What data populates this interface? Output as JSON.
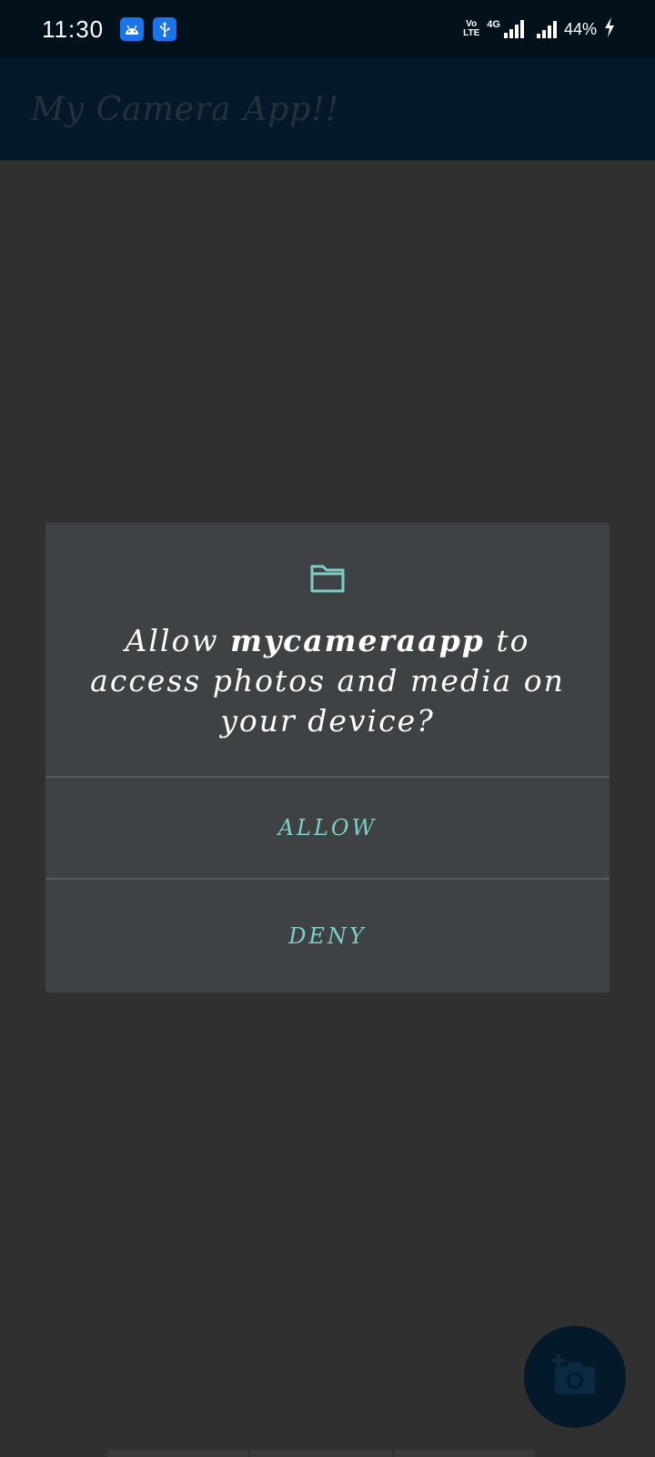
{
  "status_bar": {
    "time": "11:30",
    "notification_icons": [
      "android-icon",
      "usb-icon"
    ],
    "volte_top": "Vo",
    "volte_bottom": "LTE",
    "network": "4G",
    "battery": "44%"
  },
  "app_bar": {
    "title": "My Camera App!!"
  },
  "dialog": {
    "icon": "folder-icon",
    "message_prefix": "Allow ",
    "app_name": "mycameraapp",
    "message_suffix": " to access photos and media on your device?",
    "allow_label": "ALLOW",
    "deny_label": "DENY"
  },
  "fab": {
    "icon": "add-photo-icon"
  },
  "colors": {
    "accent": "#7fcfc8",
    "dialog_bg": "#3e4245",
    "scrim_bg": "#303030",
    "app_bar_bg": "#041a2b"
  }
}
